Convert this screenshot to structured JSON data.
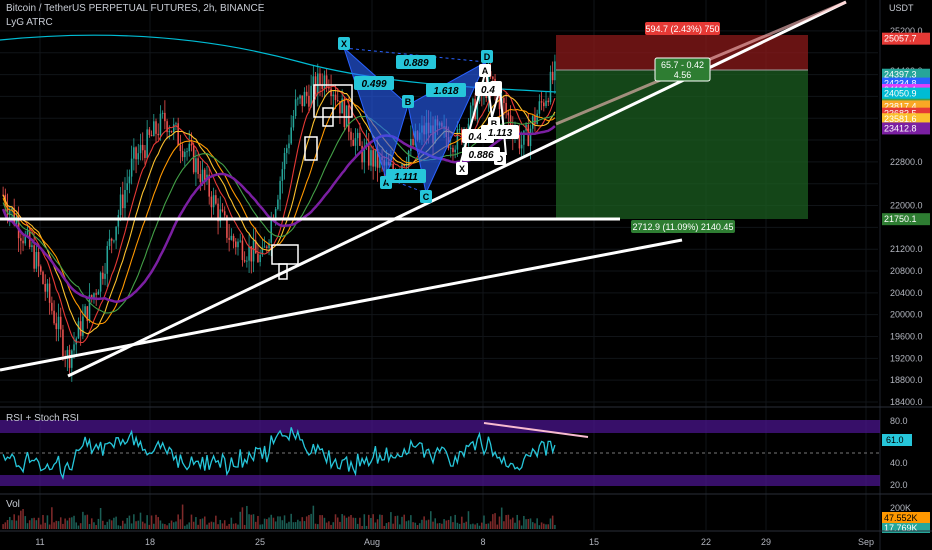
{
  "header": {
    "title": "Bitcoin / TetherUS PERPETUAL FUTURES, 2h, BINANCE",
    "indicator": "LyG ATRC",
    "currency": "USDT"
  },
  "price_axis": {
    "ticks": [
      "25200.0",
      "24463.0",
      "24000.0",
      "23600.0",
      "22800.0",
      "22000.0",
      "21200.0",
      "20800.0",
      "20400.0",
      "20000.0",
      "19600.0",
      "19200.0",
      "18800.0",
      "18400.0"
    ]
  },
  "price_badges": [
    {
      "text": "25057.7",
      "color": "#e53935"
    },
    {
      "text": "24397.3",
      "color": "#26a69a"
    },
    {
      "text": "01:04:32",
      "color": "#26a69a"
    },
    {
      "text": "24234.8",
      "color": "#2962ff"
    },
    {
      "text": "24116.4",
      "color": "#e040fb"
    },
    {
      "text": "24050.9",
      "color": "#00bcd4"
    },
    {
      "text": "23847.5",
      "color": "#43a047"
    },
    {
      "text": "23817.4",
      "color": "#f9a825"
    },
    {
      "text": "23683.5",
      "color": "#e53935"
    },
    {
      "text": "23581.6",
      "color": "#fbc02d"
    },
    {
      "text": "23412.8",
      "color": "#7b1fa2"
    },
    {
      "text": "21750.1",
      "color": "#2e7d32"
    }
  ],
  "position": {
    "stop_label": "594.7 (2.43%) 750",
    "rr_label_1": "65.7 - 0.42",
    "rr_label_2": "4.56",
    "target_label": "2712.9 (11.09%) 2140.45"
  },
  "pattern": {
    "points": [
      "X",
      "A",
      "B",
      "C",
      "D"
    ],
    "ratios": [
      "0.499",
      "0.889",
      "1.618",
      "1.111"
    ],
    "small_pattern": {
      "points": [
        "X",
        "A",
        "B",
        "C",
        "D"
      ],
      "ratios": [
        "0.44",
        "0.886",
        "1.113",
        "0.4"
      ]
    }
  },
  "rsi_panel": {
    "title": "RSI + Stoch RSI",
    "ticks": [
      "80.0",
      "40.0",
      "20.0"
    ],
    "value": "61.0"
  },
  "vol_panel": {
    "title": "Vol",
    "ticks": [
      "200K"
    ],
    "badge1": "47.552K",
    "badge2": "17.769K"
  },
  "time_axis": {
    "labels": [
      "11",
      "18",
      "25",
      "Aug",
      "8",
      "15",
      "22",
      "29",
      "Sep"
    ]
  },
  "colors": {
    "background": "#000000",
    "up": "#26a69a",
    "down": "#ef5350",
    "pattern_fill": "#2962ff",
    "stop_zone": "#8b1a1a",
    "target_zone": "#1b5e20"
  },
  "chart_data": {
    "type": "candlestick",
    "title": "Bitcoin / TetherUS PERPETUAL FUTURES, 2h, BINANCE",
    "ylim": [
      18400,
      25400
    ],
    "y_unit": "USDT",
    "approx_close_path": [
      {
        "x": "Jul 9",
        "y": 22200
      },
      {
        "x": "Jul 11",
        "y": 21000
      },
      {
        "x": "Jul 13",
        "y": 19200
      },
      {
        "x": "Jul 15",
        "y": 20700
      },
      {
        "x": "Jul 18",
        "y": 22800
      },
      {
        "x": "Jul 20",
        "y": 23600
      },
      {
        "x": "Jul 22",
        "y": 22700
      },
      {
        "x": "Jul 25",
        "y": 21400
      },
      {
        "x": "Jul 26",
        "y": 21000
      },
      {
        "x": "Jul 28",
        "y": 23800
      },
      {
        "x": "Jul 30",
        "y": 24400
      },
      {
        "x": "Aug 1",
        "y": 23000
      },
      {
        "x": "Aug 3",
        "y": 22600
      },
      {
        "x": "Aug 5",
        "y": 23400
      },
      {
        "x": "Aug 7",
        "y": 23200
      },
      {
        "x": "Aug 8",
        "y": 24300
      },
      {
        "x": "Aug 9",
        "y": 23100
      },
      {
        "x": "Aug 10",
        "y": 24397
      }
    ],
    "rsi_last": 61.0
  }
}
